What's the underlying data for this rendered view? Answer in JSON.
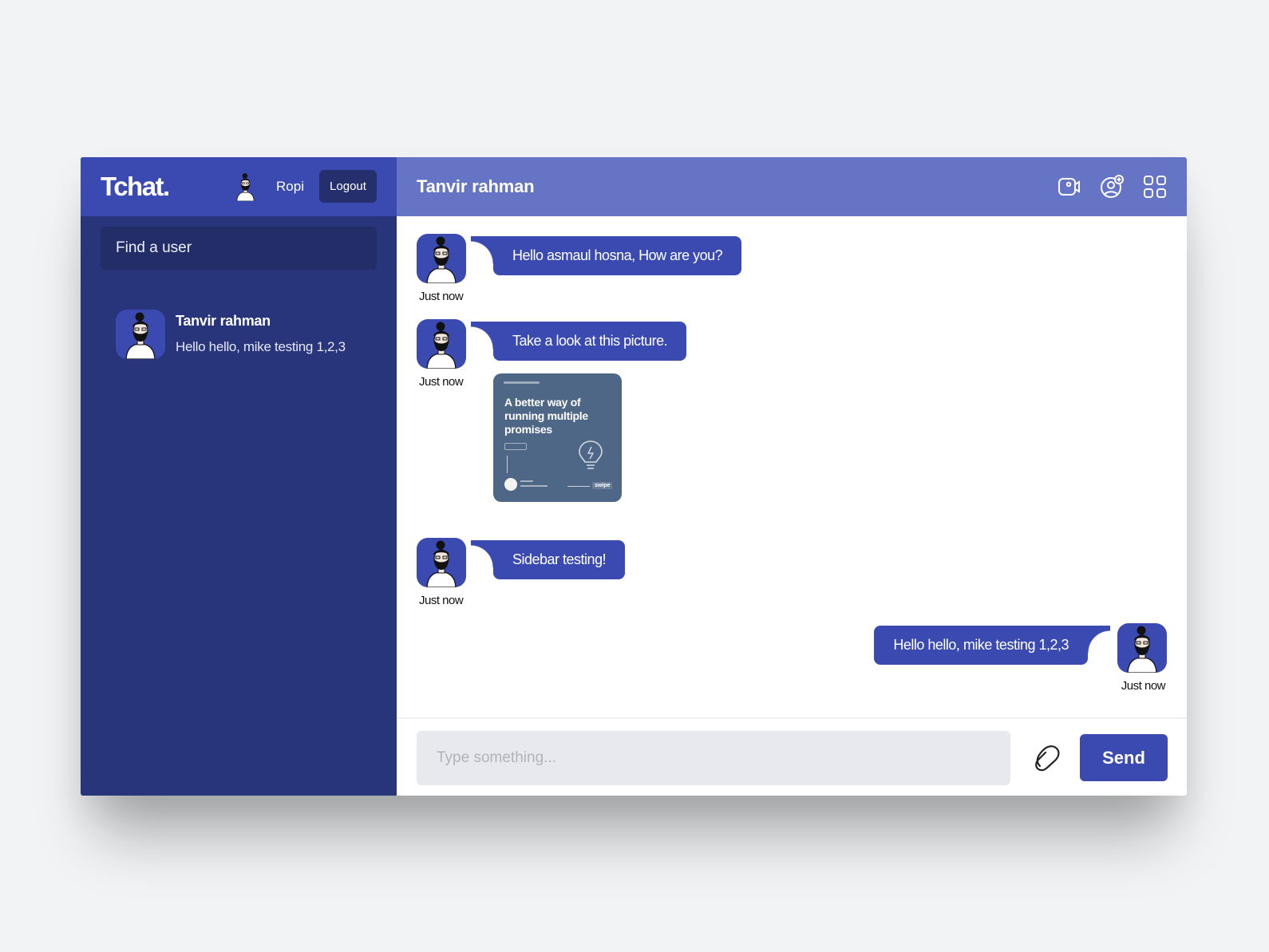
{
  "sidebar": {
    "logo": "Tchat.",
    "current_user": {
      "name": "Ropi",
      "avatar": "user-avatar-icon"
    },
    "logout_label": "Logout",
    "search_placeholder": "Find a user",
    "contacts": [
      {
        "name": "Tanvir rahman",
        "last_message": "Hello hello, mike testing 1,2,3",
        "avatar": "user-avatar-icon"
      }
    ]
  },
  "chat": {
    "title": "Tanvir rahman",
    "header_icons": [
      "video-camera-icon",
      "add-user-icon",
      "grid-menu-icon"
    ],
    "messages": [
      {
        "side": "left",
        "text": "Hello asmaul hosna, How are you?",
        "time": "Just now"
      },
      {
        "side": "left",
        "text": "Take a look at this picture.",
        "time": "Just now",
        "image": {
          "title": "A better way of running multiple promises"
        }
      },
      {
        "side": "left",
        "text": "Sidebar testing!",
        "time": "Just now"
      },
      {
        "side": "right",
        "text": "Hello hello, mike testing 1,2,3",
        "time": "Just now"
      }
    ]
  },
  "input_bar": {
    "placeholder": "Type something...",
    "attach_icon": "attach-icon",
    "send_label": "Send"
  },
  "colors": {
    "sidebar_bg": "#28357a",
    "sidebar_header_bg": "#3a4ab0",
    "chat_header_bg": "#6674c6",
    "bubble_bg": "#3a4ab0",
    "input_bg": "#e8e9ee",
    "page_bg": "#f2f3f5"
  }
}
